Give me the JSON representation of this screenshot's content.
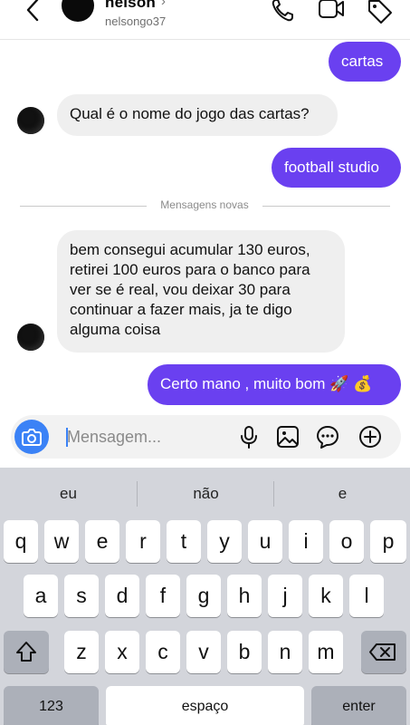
{
  "header": {
    "name": "nelson",
    "chevron": "›",
    "username": "nelsongo37",
    "icons": [
      "back-arrow-icon",
      "phone-icon",
      "video-camera-icon",
      "tag-icon"
    ]
  },
  "messages": [
    {
      "direction": "outgoing",
      "text": "cartas"
    },
    {
      "direction": "incoming",
      "text": "Qual é o nome do jogo das cartas?"
    },
    {
      "direction": "outgoing",
      "text": "football studio"
    },
    {
      "direction": "incoming",
      "lines": [
        "bem consegui acumular 130 euros,",
        "retirei 100 euros para o banco para",
        "ver se é real, vou deixar 30 para",
        "continuar a fazer mais, ja te digo",
        "alguma coisa"
      ]
    },
    {
      "direction": "outgoing",
      "text": "Certo mano , muito bom 🚀 💰"
    }
  ],
  "divider": {
    "label": "Mensagens novas"
  },
  "composer": {
    "placeholder": "Mensagem...",
    "icons": [
      "camera-icon",
      "microphone-icon",
      "gallery-icon",
      "sticker-icon",
      "plus-icon"
    ]
  },
  "keyboard": {
    "suggestions": [
      "eu",
      "não",
      "e"
    ],
    "row1": [
      "q",
      "w",
      "e",
      "r",
      "t",
      "y",
      "u",
      "i",
      "o",
      "p"
    ],
    "row2": [
      "a",
      "s",
      "d",
      "f",
      "g",
      "h",
      "j",
      "k",
      "l"
    ],
    "row3": [
      "z",
      "x",
      "c",
      "v",
      "b",
      "n",
      "m"
    ],
    "numbers_label": "123",
    "space_label": "espaço",
    "enter_label": "enter"
  }
}
